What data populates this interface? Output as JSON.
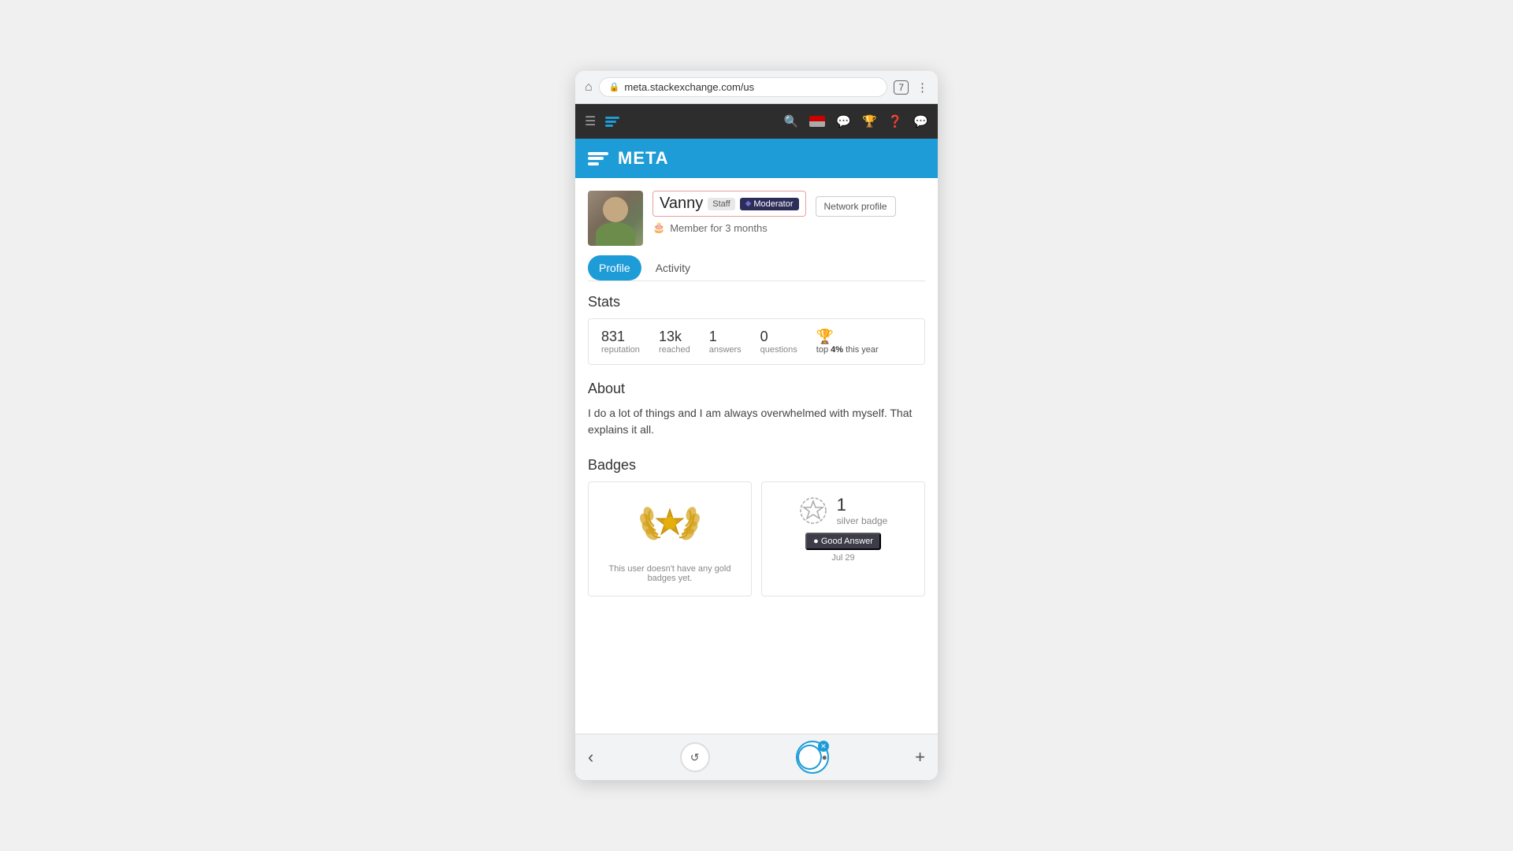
{
  "browser": {
    "url": "meta.stackexchange.com/us",
    "home_icon": "⌂",
    "lock_icon": "🔒",
    "tab_count": "7",
    "menu_icon": "⋮"
  },
  "topnav": {
    "search_icon": "🔍",
    "inbox_icon": "💬",
    "trophy_icon": "🏆",
    "help_icon": "❓",
    "chat_icon": "💭"
  },
  "site_header": {
    "title": "META"
  },
  "profile": {
    "username": "Vanny",
    "staff_label": "Staff",
    "moderator_label": "Moderator",
    "network_profile_label": "Network profile",
    "member_duration": "Member for 3 months"
  },
  "tabs": [
    {
      "label": "Profile",
      "active": true
    },
    {
      "label": "Activity",
      "active": false
    }
  ],
  "stats": {
    "title": "Stats",
    "reputation_value": "831",
    "reputation_label": "reputation",
    "reached_value": "13k",
    "reached_label": "reached",
    "answers_value": "1",
    "answers_label": "answers",
    "questions_value": "0",
    "questions_label": "questions",
    "trophy_percent": "4%",
    "trophy_label": "top 4% this year"
  },
  "about": {
    "title": "About",
    "text": "I do a lot of things and I am always overwhelmed with myself. That explains it all."
  },
  "badges": {
    "title": "Badges",
    "gold_no_badge_text": "This user doesn't have any gold badges yet.",
    "silver_count": "1",
    "silver_label": "silver badge",
    "good_answer_label": "● Good Answer",
    "badge_date": "Jul 29"
  },
  "bottom_bar": {
    "back_icon": "‹",
    "refresh_icon": "↺",
    "plus_icon": "+"
  }
}
